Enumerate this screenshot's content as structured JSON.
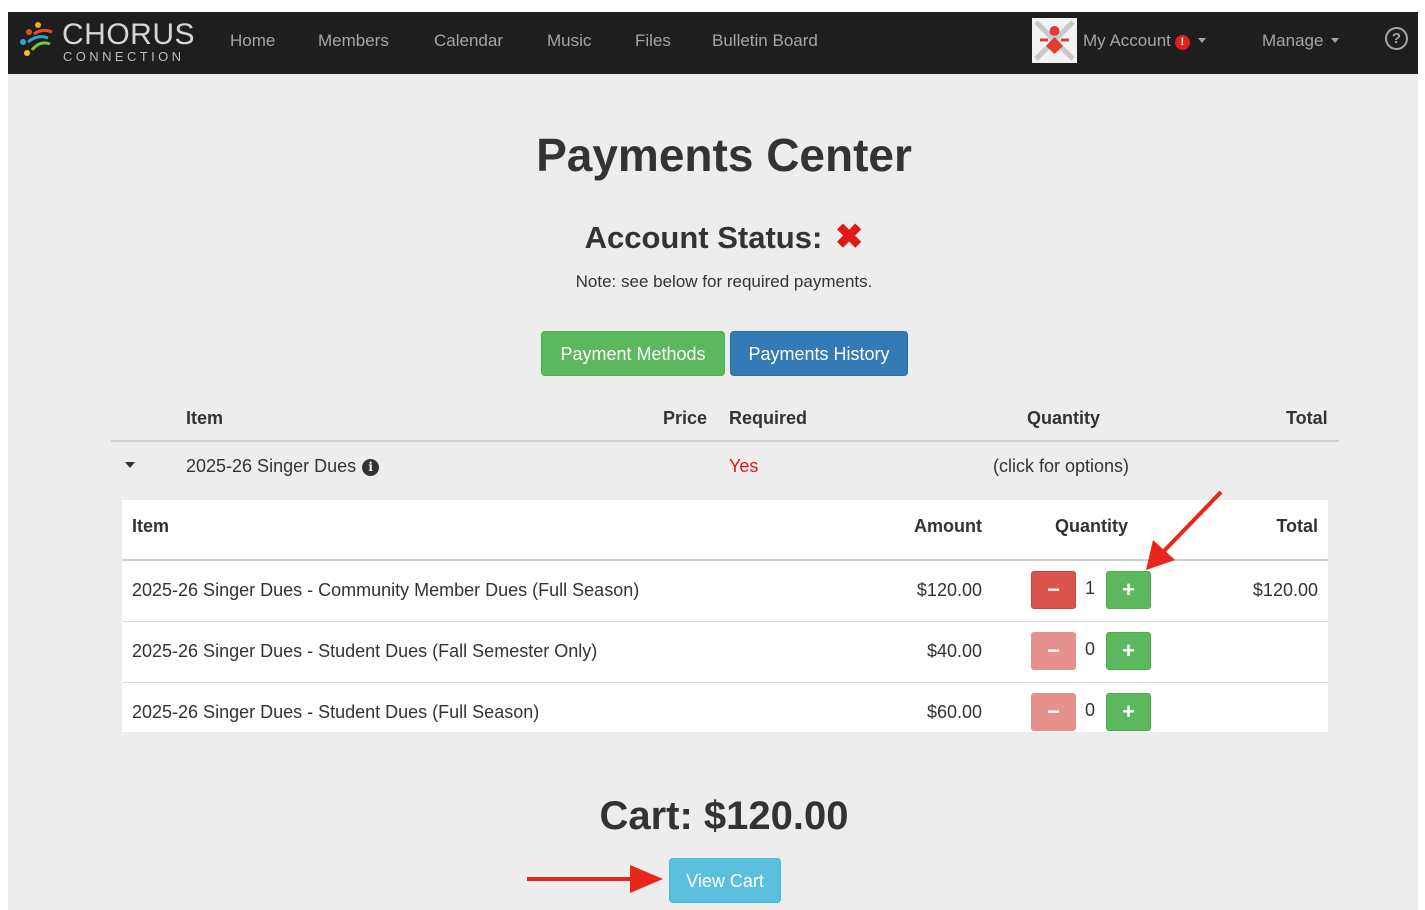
{
  "brand": {
    "name": "CHORUS",
    "sub": "CONNECTION"
  },
  "nav": {
    "links": [
      "Home",
      "Members",
      "Calendar",
      "Music",
      "Files",
      "Bulletin Board"
    ],
    "account_label": "My Account",
    "account_alert": "!",
    "manage_label": "Manage",
    "help_label": "?"
  },
  "page": {
    "title": "Payments Center",
    "status_label": "Account Status:",
    "status_mark": "✖",
    "note": "Note: see below for required payments.",
    "buttons": {
      "methods": "Payment Methods",
      "history": "Payments History",
      "view_cart": "View Cart"
    }
  },
  "payments_table": {
    "headers": {
      "item": "Item",
      "price": "Price",
      "required": "Required",
      "quantity": "Quantity",
      "total": "Total"
    },
    "row": {
      "item": "2025-26 Singer Dues",
      "required": "Yes",
      "quantity": "(click for options)"
    }
  },
  "options_table": {
    "headers": {
      "item": "Item",
      "amount": "Amount",
      "quantity": "Quantity",
      "total": "Total"
    },
    "rows": [
      {
        "item": "2025-26 Singer Dues - Community Member Dues (Full Season)",
        "amount": "$120.00",
        "quantity": "1",
        "total": "$120.00",
        "minus_enabled": true
      },
      {
        "item": "2025-26 Singer Dues - Student Dues (Fall Semester Only)",
        "amount": "$40.00",
        "quantity": "0",
        "total": "",
        "minus_enabled": false
      },
      {
        "item": "2025-26 Singer Dues - Student Dues (Full Season)",
        "amount": "$60.00",
        "quantity": "0",
        "total": "",
        "minus_enabled": false
      }
    ],
    "minus_symbol": "−",
    "plus_symbol": "+"
  },
  "cart": {
    "label": "Cart: $120.00"
  },
  "colors": {
    "navbar": "#1e1e1e",
    "required": "#e01818",
    "green": "#5cb85c",
    "blue": "#337ab7",
    "info": "#5bc0de",
    "danger": "#d9534f",
    "annotation_arrow": "#e8261c"
  }
}
